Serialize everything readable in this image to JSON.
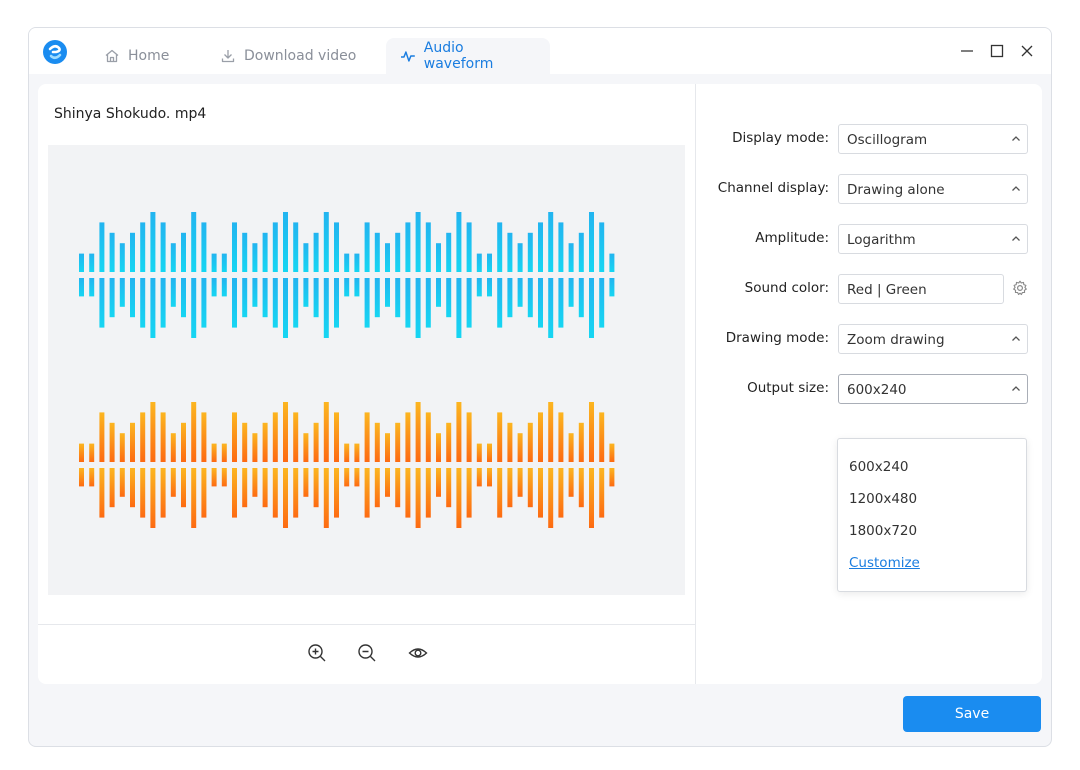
{
  "tabs": [
    {
      "label": "Home",
      "icon": "home-icon"
    },
    {
      "label": "Download video",
      "icon": "download-icon"
    },
    {
      "label": "Audio waveform",
      "icon": "waveform-icon"
    }
  ],
  "colors": {
    "accent": "#1a7de0",
    "button": "#1a8cf0",
    "wave_top_start": "#23b4f0",
    "wave_top_end": "#16d6f2",
    "wave_bottom_start": "#fcb620",
    "wave_bottom_end": "#fd6a12"
  },
  "preview": {
    "filename": "Shinya Shokudo. mp4"
  },
  "settings": {
    "display_mode": {
      "label": "Display mode:",
      "value": "Oscillogram"
    },
    "channel_display": {
      "label": "Channel display:",
      "value": "Drawing alone"
    },
    "amplitude": {
      "label": "Amplitude:",
      "value": "Logarithm"
    },
    "sound_color": {
      "label": "Sound color:",
      "value": "Red | Green"
    },
    "drawing_mode": {
      "label": "Drawing mode:",
      "value": "Zoom drawing"
    },
    "output_size": {
      "label": "Output size:",
      "value": "600x240",
      "options": [
        "600x240",
        "1200x480",
        "1800x720",
        "Customize"
      ]
    }
  },
  "tools": [
    "zoom-in-icon",
    "zoom-out-icon",
    "eye-icon"
  ],
  "save_label": "Save"
}
